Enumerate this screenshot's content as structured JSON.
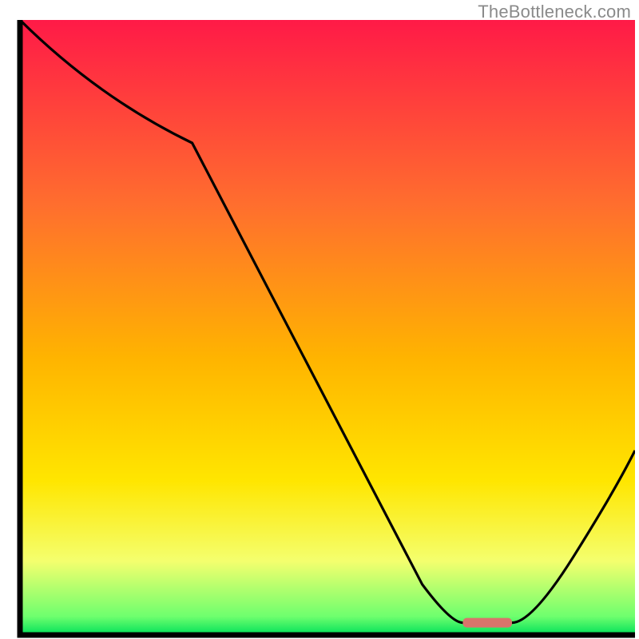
{
  "watermark": "TheBottleneck.com",
  "chart_data": {
    "type": "line",
    "title": "",
    "xlabel": "",
    "ylabel": "",
    "xlim": [
      0,
      100
    ],
    "ylim": [
      0,
      100
    ],
    "x": [
      0,
      28,
      72,
      80,
      100
    ],
    "values": [
      100,
      80,
      2,
      2,
      30
    ],
    "marker": {
      "x_start": 72,
      "x_end": 80,
      "y": 2,
      "color": "#d9746b"
    },
    "background_gradient": {
      "stops": [
        {
          "offset": 0.0,
          "color": "#ff1a47"
        },
        {
          "offset": 0.3,
          "color": "#ff6e2e"
        },
        {
          "offset": 0.55,
          "color": "#ffb400"
        },
        {
          "offset": 0.75,
          "color": "#ffe600"
        },
        {
          "offset": 0.88,
          "color": "#f4ff6e"
        },
        {
          "offset": 0.97,
          "color": "#6eff6e"
        },
        {
          "offset": 1.0,
          "color": "#00e05a"
        }
      ]
    }
  }
}
